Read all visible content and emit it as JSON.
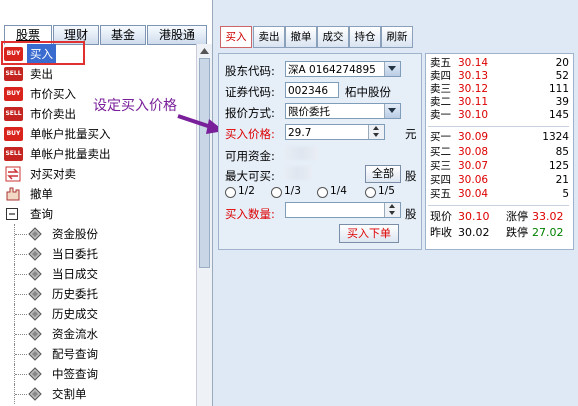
{
  "nav_tabs": [
    "股票",
    "理财",
    "基金",
    "港股通"
  ],
  "tree": {
    "items": [
      {
        "label": "买入",
        "badge": "BUY"
      },
      {
        "label": "卖出",
        "badge": "SELL"
      },
      {
        "label": "市价买入",
        "badge": "BUY"
      },
      {
        "label": "市价卖出",
        "badge": "SELL"
      },
      {
        "label": "单帐户批量买入",
        "badge": "BUY"
      },
      {
        "label": "单帐户批量卖出",
        "badge": "SELL"
      },
      {
        "label": "对买对卖",
        "badge": ""
      },
      {
        "label": "撤单",
        "badge": ""
      },
      {
        "label": "查询",
        "badge": ""
      }
    ],
    "children": [
      "资金股份",
      "当日委托",
      "当日成交",
      "历史委托",
      "历史成交",
      "资金流水",
      "配号查询",
      "中签查询",
      "交割单"
    ]
  },
  "toolbar": [
    "买入",
    "卖出",
    "撤单",
    "成交",
    "持仓",
    "刷新"
  ],
  "annotation": "设定买入价格",
  "form": {
    "account_label": "股东代码:",
    "account_value": "深A 0164274895",
    "code_label": "证券代码:",
    "code_value": "002346",
    "stock_name": "柘中股份",
    "price_mode_label": "报价方式:",
    "price_mode_value": "限价委托",
    "price_label": "买入价格:",
    "price_value": "29.7",
    "price_unit": "元",
    "funds_label": "可用资金:",
    "max_label": "最大可买:",
    "all_button": "全部",
    "max_unit": "股",
    "fractions": [
      "1/2",
      "1/3",
      "1/4",
      "1/5"
    ],
    "qty_label": "买入数量:",
    "qty_unit": "股",
    "submit_button": "买入下单"
  },
  "quotes": {
    "sells": [
      {
        "name": "卖五",
        "price": "30.14",
        "vol": "20"
      },
      {
        "name": "卖四",
        "price": "30.13",
        "vol": "52"
      },
      {
        "name": "卖三",
        "price": "30.12",
        "vol": "111"
      },
      {
        "name": "卖二",
        "price": "30.11",
        "vol": "39"
      },
      {
        "name": "卖一",
        "price": "30.10",
        "vol": "145"
      }
    ],
    "buys": [
      {
        "name": "买一",
        "price": "30.09",
        "vol": "1324"
      },
      {
        "name": "买二",
        "price": "30.08",
        "vol": "85"
      },
      {
        "name": "买三",
        "price": "30.07",
        "vol": "125"
      },
      {
        "name": "买四",
        "price": "30.06",
        "vol": "21"
      },
      {
        "name": "买五",
        "price": "30.04",
        "vol": "5"
      }
    ],
    "current_label": "现价",
    "current_value": "30.10",
    "limit_up_label": "涨停",
    "limit_up_value": "33.02",
    "prev_close_label": "昨收",
    "prev_close_value": "30.02",
    "limit_down_label": "跌停",
    "limit_down_value": "27.02"
  },
  "colors": {
    "price_red": "#d00000",
    "limit_down_green": "#008000",
    "highlight_box": "#e03030",
    "arrow": "#7a1f9a"
  }
}
